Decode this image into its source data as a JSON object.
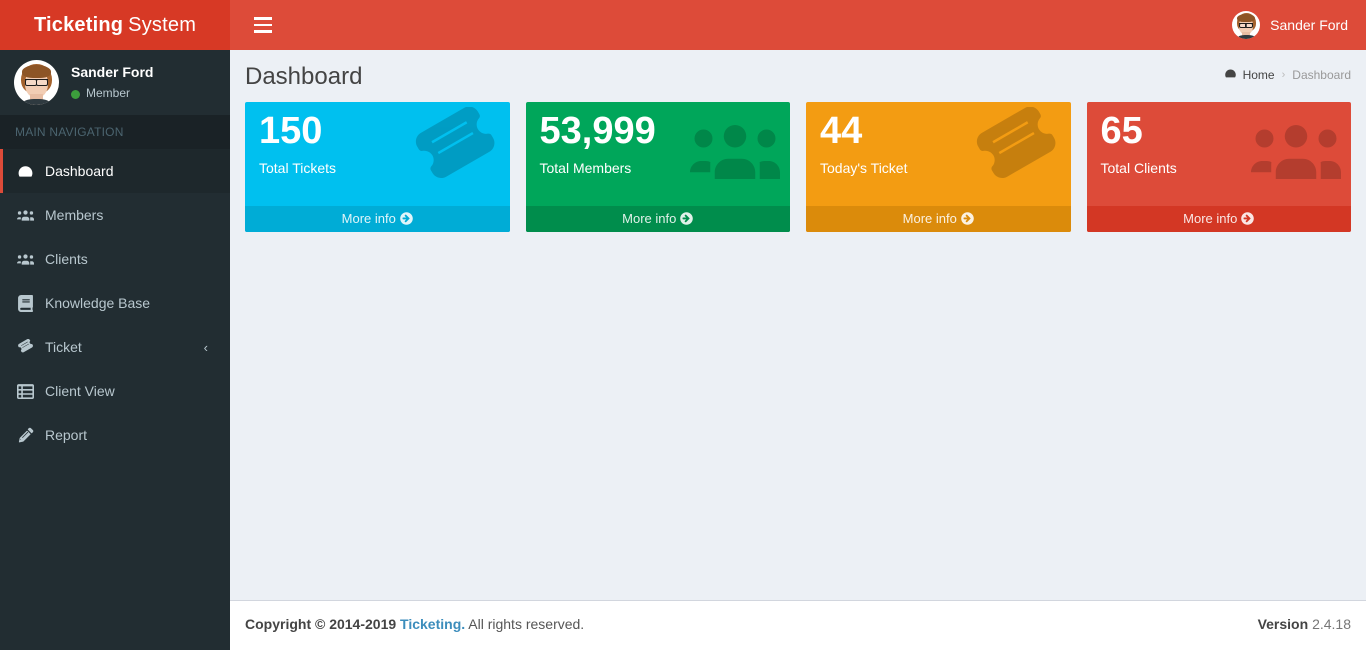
{
  "logo": {
    "bold": "Ticketing",
    "light": "System"
  },
  "navbar": {
    "menu_toggle_name": "Toggle navigation",
    "user_name": "Sander Ford"
  },
  "sidebar": {
    "user": {
      "name": "Sander Ford",
      "status": "Member",
      "status_color": "#3c9e3c"
    },
    "nav_header": "MAIN NAVIGATION",
    "items": [
      {
        "label": "Dashboard",
        "icon": "dashboard-icon",
        "active": true,
        "chevron": ""
      },
      {
        "label": "Members",
        "icon": "users-icon",
        "active": false,
        "chevron": ""
      },
      {
        "label": "Clients",
        "icon": "users-icon",
        "active": false,
        "chevron": ""
      },
      {
        "label": "Knowledge Base",
        "icon": "book-icon",
        "active": false,
        "chevron": ""
      },
      {
        "label": "Ticket",
        "icon": "ticket-icon",
        "active": false,
        "chevron": "‹"
      },
      {
        "label": "Client View",
        "icon": "list-icon",
        "active": false,
        "chevron": ""
      },
      {
        "label": "Report",
        "icon": "edit-icon",
        "active": false,
        "chevron": ""
      }
    ]
  },
  "content": {
    "page_title": "Dashboard",
    "breadcrumb": {
      "home": "Home",
      "separator": "›",
      "current": "Dashboard"
    }
  },
  "boxes": [
    {
      "value": "150",
      "label": "Total Tickets",
      "link": "More info",
      "color": "#00c0ef",
      "footer_color": "#00acd6",
      "icon": "ticket-icon"
    },
    {
      "value": "53,999",
      "label": "Total Members",
      "link": "More info",
      "color": "#00a65a",
      "footer_color": "#008d4c",
      "icon": "users-group-icon"
    },
    {
      "value": "44",
      "label": "Today's Ticket",
      "link": "More info",
      "color": "#f39c12",
      "footer_color": "#db8b0b",
      "icon": "ticket-icon"
    },
    {
      "value": "65",
      "label": "Total Clients",
      "link": "More info",
      "color": "#dd4b39",
      "footer_color": "#d33724",
      "icon": "users-group-icon"
    }
  ],
  "footer": {
    "copyright_bold": "Copyright © 2014-2019",
    "brand_link": "Ticketing.",
    "copyright_rest": "All rights reserved.",
    "version_label": "Version",
    "version_number": "2.4.18"
  }
}
